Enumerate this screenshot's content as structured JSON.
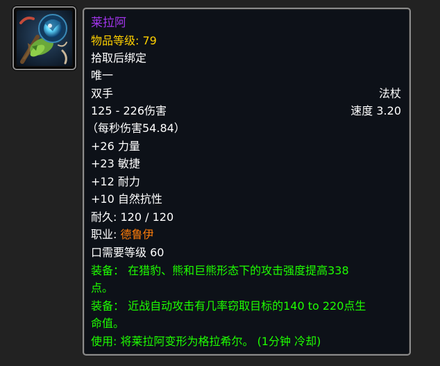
{
  "item": {
    "name": "莱拉阿",
    "item_level_label": "物品等级:",
    "item_level_value": "79",
    "binding": "拾取后绑定",
    "unique": "唯一",
    "slot": "双手",
    "weapon_type": "法杖",
    "damage": "125 - 226伤害",
    "speed": "速度 3.20",
    "dps": "（每秒伤害54.84）",
    "stats": [
      "+26 力量",
      "+23 敏捷",
      "+12 耐力",
      "+10 自然抗性"
    ],
    "durability": "耐久: 120 / 120",
    "class_label": "职业: ",
    "class_value": "德鲁伊",
    "required_level": "口需要等级 60",
    "effects": [
      "装备： 在猎豹、熊和巨熊形态下的攻击强度提高338",
      "点。",
      "装备： 近战自动攻击有几率窃取目标的140 to 220点生",
      "命值。",
      "使用: 将莱拉阿变形为格拉希尔。 (1分钟 冷却)"
    ]
  },
  "colors": {
    "name": "#a335ee",
    "item_level": "#ffd100",
    "class": "#ff7d0a",
    "effect": "#1eff00",
    "text": "#ffffff",
    "background": "#222222",
    "tooltip_bg": "#0d1118"
  },
  "icon": "staff-item-icon"
}
